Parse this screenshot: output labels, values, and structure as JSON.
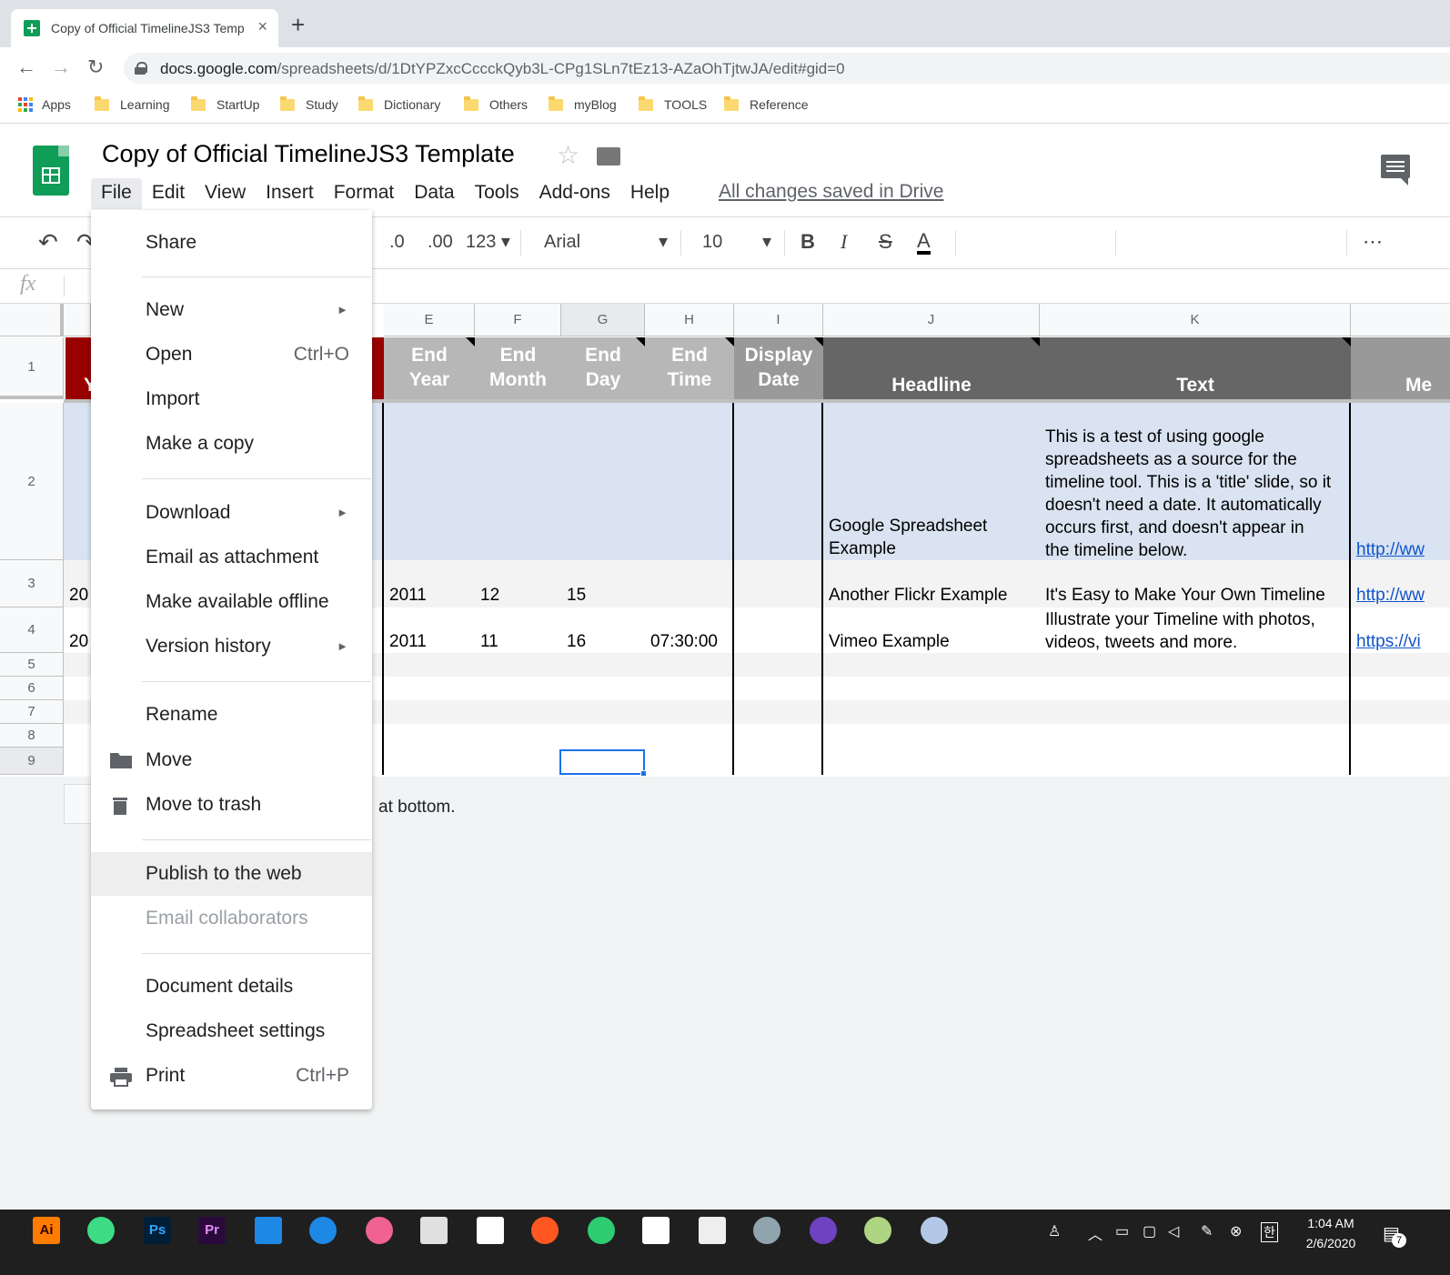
{
  "browser": {
    "tab_title": "Copy of Official TimelineJS3 Temp",
    "tab_close": "×",
    "new_tab": "+",
    "url_host": "docs.google.com",
    "url_path": "/spreadsheets/d/1DtYPZxcCccckQyb3L-CPg1SLn7tEz13-AZaOhTjtwJA/edit#gid=0",
    "back": "←",
    "forward": "→",
    "reload": "↻",
    "apps_label": "Apps",
    "bookmarks": [
      "Learning",
      "StartUp",
      "Study",
      "Dictionary",
      "Others",
      "myBlog",
      "TOOLS",
      "Reference"
    ]
  },
  "doc": {
    "title": "Copy of Official TimelineJS3 Template",
    "star": "☆",
    "saved_status": "All changes saved in Drive",
    "menu": [
      "File",
      "Edit",
      "View",
      "Insert",
      "Format",
      "Data",
      "Tools",
      "Add-ons",
      "Help"
    ]
  },
  "toolbar": {
    "undo": "↶",
    "redo": "↷",
    "dec_decimal": ".0",
    "inc_decimal": ".00",
    "format": "123",
    "font": "Arial",
    "size": "10",
    "bold": "B",
    "italic": "I",
    "strike": "S",
    "text_color": "A",
    "more": "⋯",
    "fx": "fx"
  },
  "columns": [
    {
      "id": "E",
      "label": "E"
    },
    {
      "id": "F",
      "label": "F"
    },
    {
      "id": "G",
      "label": "G"
    },
    {
      "id": "H",
      "label": "H"
    },
    {
      "id": "I",
      "label": "I"
    },
    {
      "id": "J",
      "label": "J"
    },
    {
      "id": "K",
      "label": "K"
    }
  ],
  "rows": [
    "1",
    "2",
    "3",
    "4",
    "5",
    "6",
    "7",
    "8",
    "9"
  ],
  "header_row": {
    "partial_left": "Y",
    "end_year": [
      "End",
      "Year"
    ],
    "end_month": [
      "End",
      "Month"
    ],
    "end_day": [
      "End",
      "Day"
    ],
    "end_time": [
      "End",
      "Time"
    ],
    "display_date": [
      "Display",
      "Date"
    ],
    "headline": "Headline",
    "text": "Text",
    "partial_right": "Me"
  },
  "data_rows": [
    {
      "partial_left": "",
      "end_year": "",
      "end_month": "",
      "end_day": "",
      "end_time": "",
      "headline": [
        "Google Spreadsheet",
        "Example"
      ],
      "text": [
        "This is a test of using google",
        "spreadsheets as a source for the",
        "timeline tool. This is a 'title' slide, so it",
        "doesn't need a date. It automatically",
        "occurs first, and doesn't appear in",
        "the timeline below."
      ],
      "media": "http://ww"
    },
    {
      "partial_left": "20",
      "end_year": "2011",
      "end_month": "12",
      "end_day": "15",
      "end_time": "",
      "headline": [
        "Another Flickr Example"
      ],
      "text": [
        "It's Easy to Make Your Own Timeline"
      ],
      "media": "http://ww"
    },
    {
      "partial_left": "20",
      "end_year": "2011",
      "end_month": "11",
      "end_day": "16",
      "end_time": "07:30:00",
      "headline": [
        "Vimeo Example"
      ],
      "text": [
        "Illustrate your Timeline with photos,",
        "videos, tweets and more."
      ],
      "media": "https://vi"
    }
  ],
  "bottom_text": "at bottom.",
  "file_menu": {
    "share": "Share",
    "new": "New",
    "open": "Open",
    "open_shortcut": "Ctrl+O",
    "import": "Import",
    "make_copy": "Make a copy",
    "download": "Download",
    "email_attachment": "Email as attachment",
    "offline": "Make available offline",
    "version_history": "Version history",
    "rename": "Rename",
    "move": "Move",
    "trash": "Move to trash",
    "publish": "Publish to the web",
    "email_collab": "Email collaborators",
    "details": "Document details",
    "settings": "Spreadsheet settings",
    "print": "Print",
    "print_shortcut": "Ctrl+P",
    "submenu_arrow": "►"
  },
  "taskbar": {
    "time": "1:04 AM",
    "date": "2/6/2020",
    "app_labels": {
      "illustrator": "Ai",
      "photoshop": "Ps",
      "premiere": "Pr"
    },
    "notif_count": "7",
    "ime": "한"
  },
  "colors": {
    "header_dark": "#666666",
    "header_gray": "#b7b7b7",
    "header_red": "#990000",
    "selected_row": "#d9e3f1",
    "link": "#1155cc"
  }
}
